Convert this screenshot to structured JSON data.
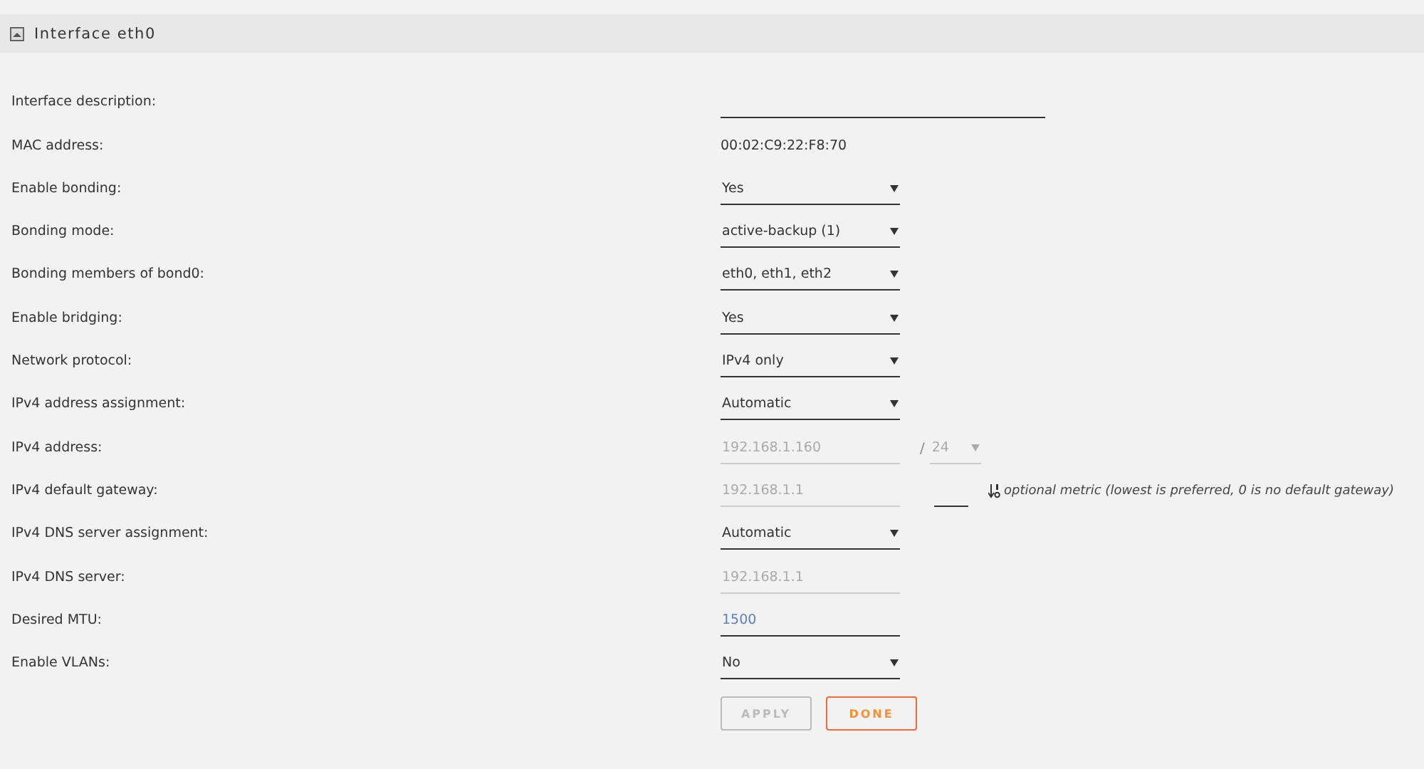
{
  "panel": {
    "title": "Interface eth0"
  },
  "rows": [
    {
      "label": "Interface description:",
      "kind": "long-text",
      "disabled": false
    },
    {
      "label": "MAC address:",
      "kind": "static",
      "value": "00:02:C9:22:F8:70"
    },
    {
      "label": "Enable bonding:",
      "kind": "select",
      "value": "Yes",
      "disabled": false
    },
    {
      "label": "Bonding mode:",
      "kind": "select",
      "value": "active-backup (1)",
      "disabled": false
    },
    {
      "label": "Bonding members of bond0:",
      "kind": "select",
      "value": "eth0, eth1, eth2",
      "disabled": false
    },
    {
      "label": "Enable bridging:",
      "kind": "select",
      "value": "Yes",
      "disabled": false
    },
    {
      "label": "Network protocol:",
      "kind": "select",
      "value": "IPv4 only",
      "disabled": false
    },
    {
      "label": "IPv4 address assignment:",
      "kind": "select",
      "value": "Automatic",
      "disabled": false
    },
    {
      "label": "IPv4 address:",
      "kind": "text",
      "value": "192.168.1.160",
      "disabled": true,
      "prefix": {
        "separator": "/",
        "value": "24",
        "disabled": true
      }
    },
    {
      "label": "IPv4 default gateway:",
      "kind": "text",
      "value": "192.168.1.1",
      "disabled": true,
      "metric_hint": "optional metric (lowest is preferred, 0 is no default gateway)"
    },
    {
      "label": "IPv4 DNS server assignment:",
      "kind": "select",
      "value": "Automatic",
      "disabled": false
    },
    {
      "label": "IPv4 DNS server:",
      "kind": "text",
      "value": "192.168.1.1",
      "disabled": true
    },
    {
      "label": "Desired MTU:",
      "kind": "text",
      "value": "1500",
      "disabled": false
    },
    {
      "label": "Enable VLANs:",
      "kind": "select",
      "value": "No",
      "disabled": false
    }
  ],
  "buttons": [
    {
      "label": "APPLY",
      "kind": "apply",
      "disabled": true
    },
    {
      "label": "DONE",
      "kind": "done",
      "disabled": false
    }
  ]
}
